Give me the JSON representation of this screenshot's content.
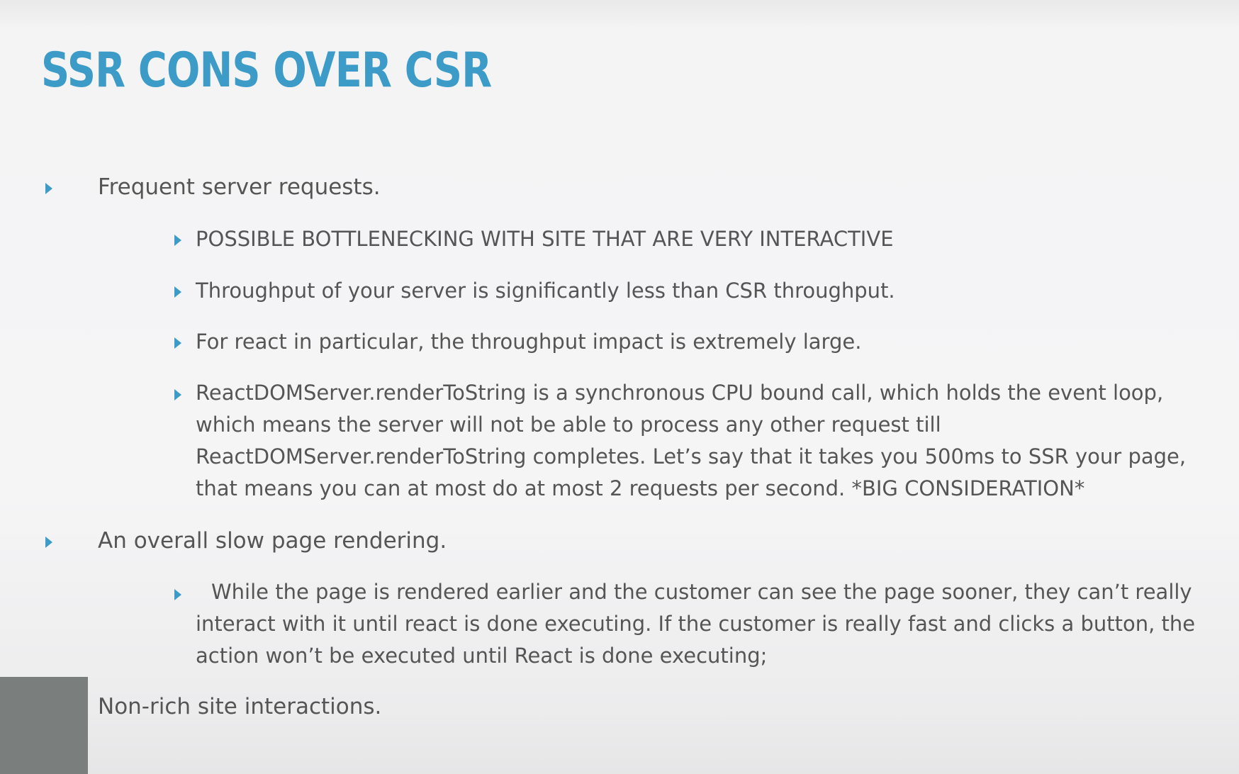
{
  "colors": {
    "title": "#3d9bc8",
    "bullet_arrow": "#3d9bc8",
    "body_text": "#555555",
    "background": "#f4f4f5",
    "thumbnail": "#7a7f7d"
  },
  "slide": {
    "title": "SSR CONS OVER CSR",
    "bullets": [
      {
        "text": "Frequent server requests.",
        "children": [
          "POSSIBLE BOTTLENECKING WITH SITE THAT ARE VERY INTERACTIVE",
          "Throughput of your server is significantly less than CSR throughput.",
          "For react in particular, the throughput impact is extremely large.",
          "ReactDOMServer.renderToString is a synchronous CPU bound call, which holds the event loop, which means the server will not be able to process any other request till ReactDOMServer.renderToString completes. Let’s say that it takes you 500ms to SSR your page, that means you can at most do at most 2 requests per second. *BIG CONSIDERATION*"
        ]
      },
      {
        "text": "An overall slow page rendering.",
        "children": [
          "While the page is rendered earlier and the customer can see the page sooner, they can’t really interact with it until react is done executing. If the customer is really fast and clicks a button, the action won’t be executed until React is done executing;"
        ]
      },
      {
        "text": "Non-rich site interactions.",
        "children": []
      }
    ]
  },
  "icons": {
    "bullet": "triangle-right-icon"
  }
}
